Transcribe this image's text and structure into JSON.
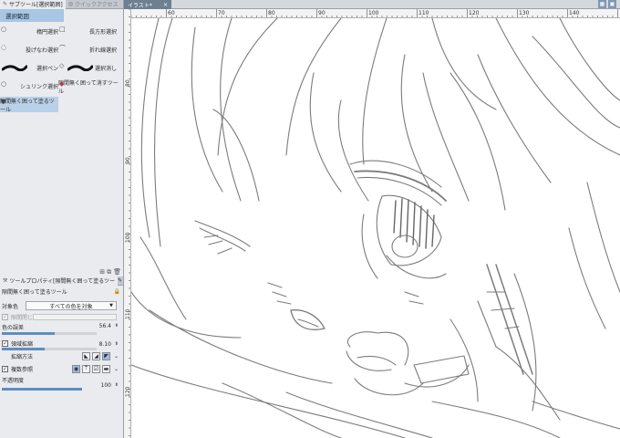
{
  "left_panel": {
    "tabs": [
      {
        "label": "サブツール[選択範囲]",
        "icon": "pen-icon",
        "active": true
      },
      {
        "label": "クイックアクセス",
        "icon": "quick-icon",
        "active": false
      }
    ],
    "group_header": "選択範囲",
    "subtools": [
      {
        "label": "楕円選択",
        "icon": "circle-icon"
      },
      {
        "label": "長方形選択",
        "icon": "square-icon"
      },
      {
        "label": "投げなわ選択",
        "icon": "lasso-icon"
      },
      {
        "label": "折れ線選択",
        "icon": "polyline-icon"
      },
      {
        "label": "選択ペン",
        "icon": "brush-icon"
      },
      {
        "label": "選択消し",
        "icon": "brush-icon"
      },
      {
        "label": "シュリンク選択",
        "icon": "circle-icon"
      },
      {
        "label": "隙間無く囲って消すツール",
        "icon": "eraser-icon"
      },
      {
        "label": "隙間無く囲って塗るツール",
        "icon": "bucket-icon",
        "selected": true
      }
    ],
    "footer_icons": [
      "add-icon",
      "copy-icon",
      "trash-icon"
    ]
  },
  "tool_property": {
    "tab_label": "ツールプロパティ[隙間無く囲って塗るツー",
    "tool_name": "隙間無く囲って塗るツール",
    "target_color_label": "対象色",
    "target_color_value": "すべての色を対象",
    "gap_close_label": "隙間閉じ",
    "color_tolerance_label": "色の誤差",
    "color_tolerance_value": "56.4",
    "area_scaling_label": "領域拡縮",
    "area_scaling_value": "8.10",
    "scaling_method_label": "拡縮方法",
    "multi_ref_label": "複数参照",
    "opacity_label": "不透明度",
    "opacity_value": "100",
    "color_tolerance_fraction": 0.56,
    "area_scaling_fraction": 0.45,
    "opacity_fraction": 1.0
  },
  "document": {
    "tab_label": "イラスト*",
    "close": "×",
    "h_ruler": [
      "60",
      "70",
      "80",
      "90",
      "100",
      "110",
      "120",
      "130",
      "140"
    ],
    "v_ruler": [
      "80",
      "90",
      "100",
      "110",
      "120"
    ]
  },
  "colors": {
    "panel_bg": "#e9ebee",
    "selection": "#a9c6e3",
    "accent": "#5f8dc4"
  }
}
